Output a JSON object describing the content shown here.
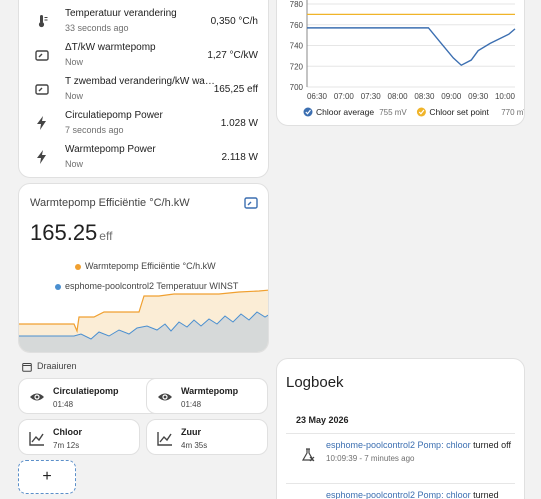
{
  "sensors": [
    {
      "name": "Temperatuur verandering",
      "time": "33 seconds ago",
      "value": "0,350 °C/h",
      "icon": "thermometer-icon"
    },
    {
      "name": "ΔT/kW warmtepomp",
      "time": "Now",
      "value": "1,27 °C/kW",
      "icon": "gauge-icon"
    },
    {
      "name": "T zwembad verandering/kW warmte...",
      "time": "Now",
      "value": "165,25 eff",
      "icon": "gauge-icon"
    },
    {
      "name": "Circulatiepomp Power",
      "time": "7 seconds ago",
      "value": "1.028 W",
      "icon": "flash-icon"
    },
    {
      "name": "Warmtepomp Power",
      "time": "Now",
      "value": "2.118 W",
      "icon": "flash-icon"
    }
  ],
  "chloor_chart": {
    "legend": [
      {
        "name": "Chloor average",
        "value": "755 mV",
        "color": "#3c6fb1"
      },
      {
        "name": "Chloor set point",
        "value": "770 mV",
        "color": "#f0b429"
      }
    ]
  },
  "chart_data": {
    "type": "line",
    "x": [
      "06:30",
      "07:00",
      "07:30",
      "08:00",
      "08:30",
      "09:00",
      "09:30",
      "10:00"
    ],
    "yticks": [
      "780",
      "760",
      "740",
      "720",
      "700"
    ],
    "ylim": [
      700,
      780
    ],
    "series": [
      {
        "name": "Chloor average",
        "values": [
          757,
          757,
          757,
          757,
          757,
          745,
          720,
          748
        ]
      },
      {
        "name": "Chloor set point",
        "values": [
          770,
          770,
          770,
          770,
          770,
          770,
          770,
          770
        ]
      }
    ]
  },
  "efficiency": {
    "title": "Warmtepomp Efficiëntie °C/h.kW",
    "value": "165.25",
    "unit": "eff",
    "legend1": "Warmtepomp Efficiëntie °C/h.kW",
    "legend2": "esphome-poolcontrol2 Temperatuur WINST",
    "color1": "#f0a030",
    "color2": "#4a8fd0"
  },
  "draaiuren": {
    "heading": "Draaiuren",
    "tiles": [
      {
        "name": "Circulatiepomp",
        "value": "01:48",
        "icon": "eye-icon"
      },
      {
        "name": "Warmtepomp",
        "value": "01:48",
        "icon": "eye-icon"
      },
      {
        "name": "Chloor",
        "value": "7m 12s",
        "icon": "chart-line-icon"
      },
      {
        "name": "Zuur",
        "value": "4m 35s",
        "icon": "chart-line-icon"
      }
    ],
    "add_label": "+"
  },
  "logbook": {
    "title": "Logboek",
    "date": "23 May 2026",
    "entries": [
      {
        "who": "esphome-poolcontrol2 Pomp: chloor",
        "what": "turned off",
        "meta": "10:09:39 - 7 minutes ago"
      },
      {
        "who": "esphome-poolcontrol2 Pomp: chloor",
        "what": "turned",
        "meta": ""
      }
    ]
  }
}
